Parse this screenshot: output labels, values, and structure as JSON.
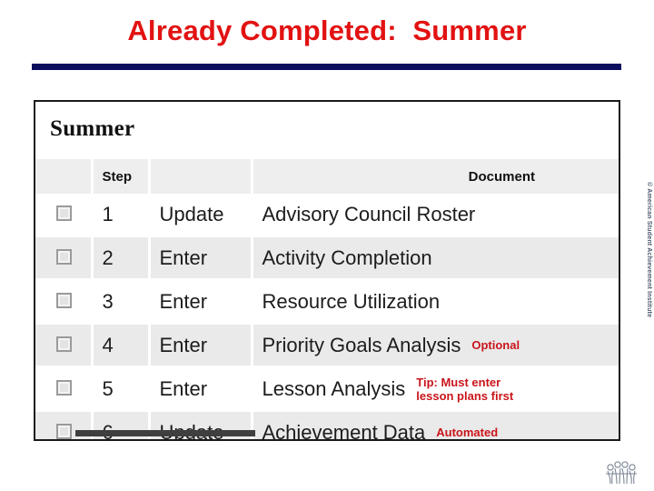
{
  "slide": {
    "title": "Already Completed:  Summer",
    "title_color": "#e21212",
    "rule_color": "#0d0d5e"
  },
  "panel": {
    "heading": "Summer",
    "table": {
      "headers": {
        "checkbox": "",
        "step": "Step",
        "action": "",
        "document": "Document"
      },
      "rows": [
        {
          "step": "1",
          "action": "Update",
          "document": "Advisory Council Roster",
          "annotation": ""
        },
        {
          "step": "2",
          "action": "Enter",
          "document": "Activity Completion",
          "annotation": ""
        },
        {
          "step": "3",
          "action": "Enter",
          "document": "Resource Utilization",
          "annotation": ""
        },
        {
          "step": "4",
          "action": "Enter",
          "document": "Priority Goals Analysis",
          "annotation": "Optional"
        },
        {
          "step": "5",
          "action": "Enter",
          "document": "Lesson Analysis",
          "annotation": "Tip:  Must enter\nlesson plans first"
        },
        {
          "step": "6",
          "action": "Update",
          "document": "Achievement Data",
          "annotation": "Automated"
        }
      ],
      "annotation_color": "#c9151b"
    }
  },
  "copyright": {
    "text": "© American Student Achievement Institute"
  }
}
